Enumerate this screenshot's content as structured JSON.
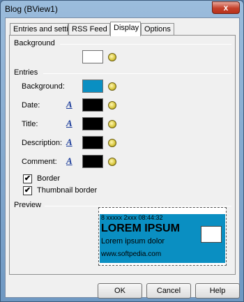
{
  "window": {
    "title": "Blog (BView1)",
    "close_glyph": "x"
  },
  "tabs": [
    {
      "label": "Entries and settings"
    },
    {
      "label": "RSS Feed"
    },
    {
      "label": "Display"
    },
    {
      "label": "Options"
    }
  ],
  "background_group": {
    "label": "Background",
    "swatch_color": "#ffffff"
  },
  "entries_group": {
    "label": "Entries",
    "rows": [
      {
        "label": "Background:",
        "color": "#0a8fc2",
        "has_font": false
      },
      {
        "label": "Date:",
        "color": "#000000",
        "has_font": true
      },
      {
        "label": "Title:",
        "color": "#000000",
        "has_font": true
      },
      {
        "label": "Description:",
        "color": "#000000",
        "has_font": true
      },
      {
        "label": "Comment:",
        "color": "#000000",
        "has_font": true
      }
    ],
    "checkboxes": [
      {
        "label": "Border",
        "checked": true
      },
      {
        "label": "Thumbnail border",
        "checked": true
      }
    ]
  },
  "preview_group": {
    "label": "Preview",
    "date": "8 xxxxx 2xxx 08:44:32",
    "title": "LOREM IPSUM",
    "description": "Lorem ipsum dolor",
    "url": "www.softpedia.com",
    "background_color": "#0a8fc2"
  },
  "buttons": {
    "ok": "OK",
    "cancel": "Cancel",
    "help": "Help"
  },
  "icons": {
    "font": "font-icon",
    "picker": "color-picker-icon",
    "check": "✔"
  }
}
